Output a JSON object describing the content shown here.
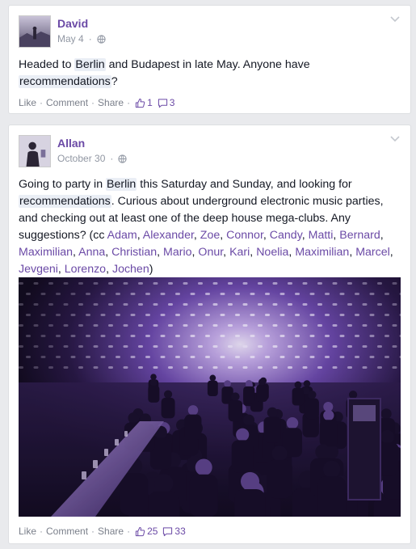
{
  "colors": {
    "accent": "#6b4aa6",
    "meta": "#9197a3",
    "page_bg": "#e9eaed"
  },
  "posts": [
    {
      "author": "David",
      "date": "May 4",
      "privacy_icon": "globe-icon",
      "text": {
        "p1": "Headed to ",
        "hl1": "Berlin",
        "p2": " and Budapest in late May. Anyone have ",
        "hl2": "recommendations",
        "p3": "?"
      },
      "actions": {
        "like": "Like",
        "comment": "Comment",
        "share": "Share",
        "sep": "·"
      },
      "likes": "1",
      "comments": "3"
    },
    {
      "author": "Allan",
      "date": "October 30",
      "privacy_icon": "globe-icon",
      "text": {
        "p1": "Going to party in ",
        "hl1": "Berlin",
        "p2": " this Saturday and Sunday, and looking for ",
        "hl2": "recommendations",
        "p3": ". Curious about underground electronic music parties, and checking out at least one of the deep house mega-clubs. Any suggestions? (cc ",
        "tags": [
          "Adam",
          "Alexander",
          "Zoe",
          "Connor",
          "Candy",
          "Matti",
          "Bernard",
          "Maximilian",
          "Anna",
          "Christian",
          "Mario",
          "Onur",
          "Kari",
          "Noelia",
          "Maximilian",
          "Marcel",
          "Jevgeni",
          "Lorenzo",
          "Jochen"
        ],
        "tag_sep": ", ",
        "p4": ")"
      },
      "actions": {
        "like": "Like",
        "comment": "Comment",
        "share": "Share",
        "sep": "·"
      },
      "likes": "25",
      "comments": "33"
    }
  ]
}
